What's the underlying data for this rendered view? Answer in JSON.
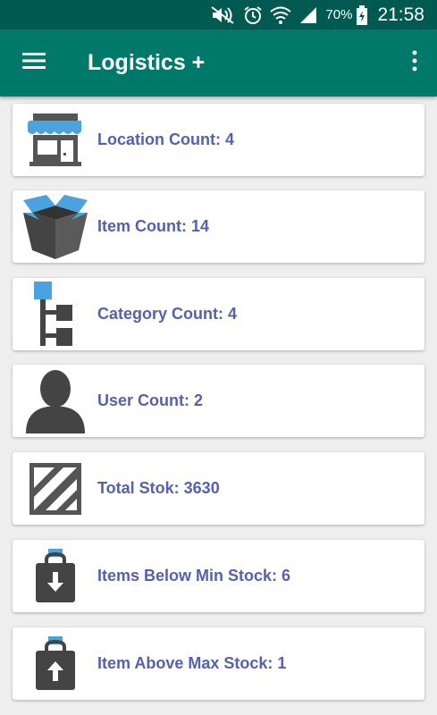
{
  "status_bar": {
    "battery_percent": "70%",
    "time": "21:58",
    "icons": [
      "mute-icon",
      "alarm-icon",
      "wifi-icon",
      "signal-icon",
      "battery-charging-icon"
    ]
  },
  "app_bar": {
    "title": "Logistics +",
    "menu_icon": "hamburger-menu-icon",
    "overflow_icon": "more-vert-icon",
    "color": "#00796b"
  },
  "dashboard": {
    "items": [
      {
        "label": "Location Count: 4",
        "icon": "store-icon"
      },
      {
        "label": "Item Count: 14",
        "icon": "box-icon"
      },
      {
        "label": "Category Count: 4",
        "icon": "category-tree-icon"
      },
      {
        "label": "User Count: 2",
        "icon": "user-icon"
      },
      {
        "label": "Total Stok: 3630",
        "icon": "crate-icon"
      },
      {
        "label": "Items Below Min Stock: 6",
        "icon": "bag-down-icon"
      },
      {
        "label": "Item Above Max Stock: 1",
        "icon": "bag-up-icon"
      }
    ]
  },
  "colors": {
    "label_text": "#5561b0",
    "icon_blue": "#4aa3df",
    "icon_dark": "#555555"
  }
}
